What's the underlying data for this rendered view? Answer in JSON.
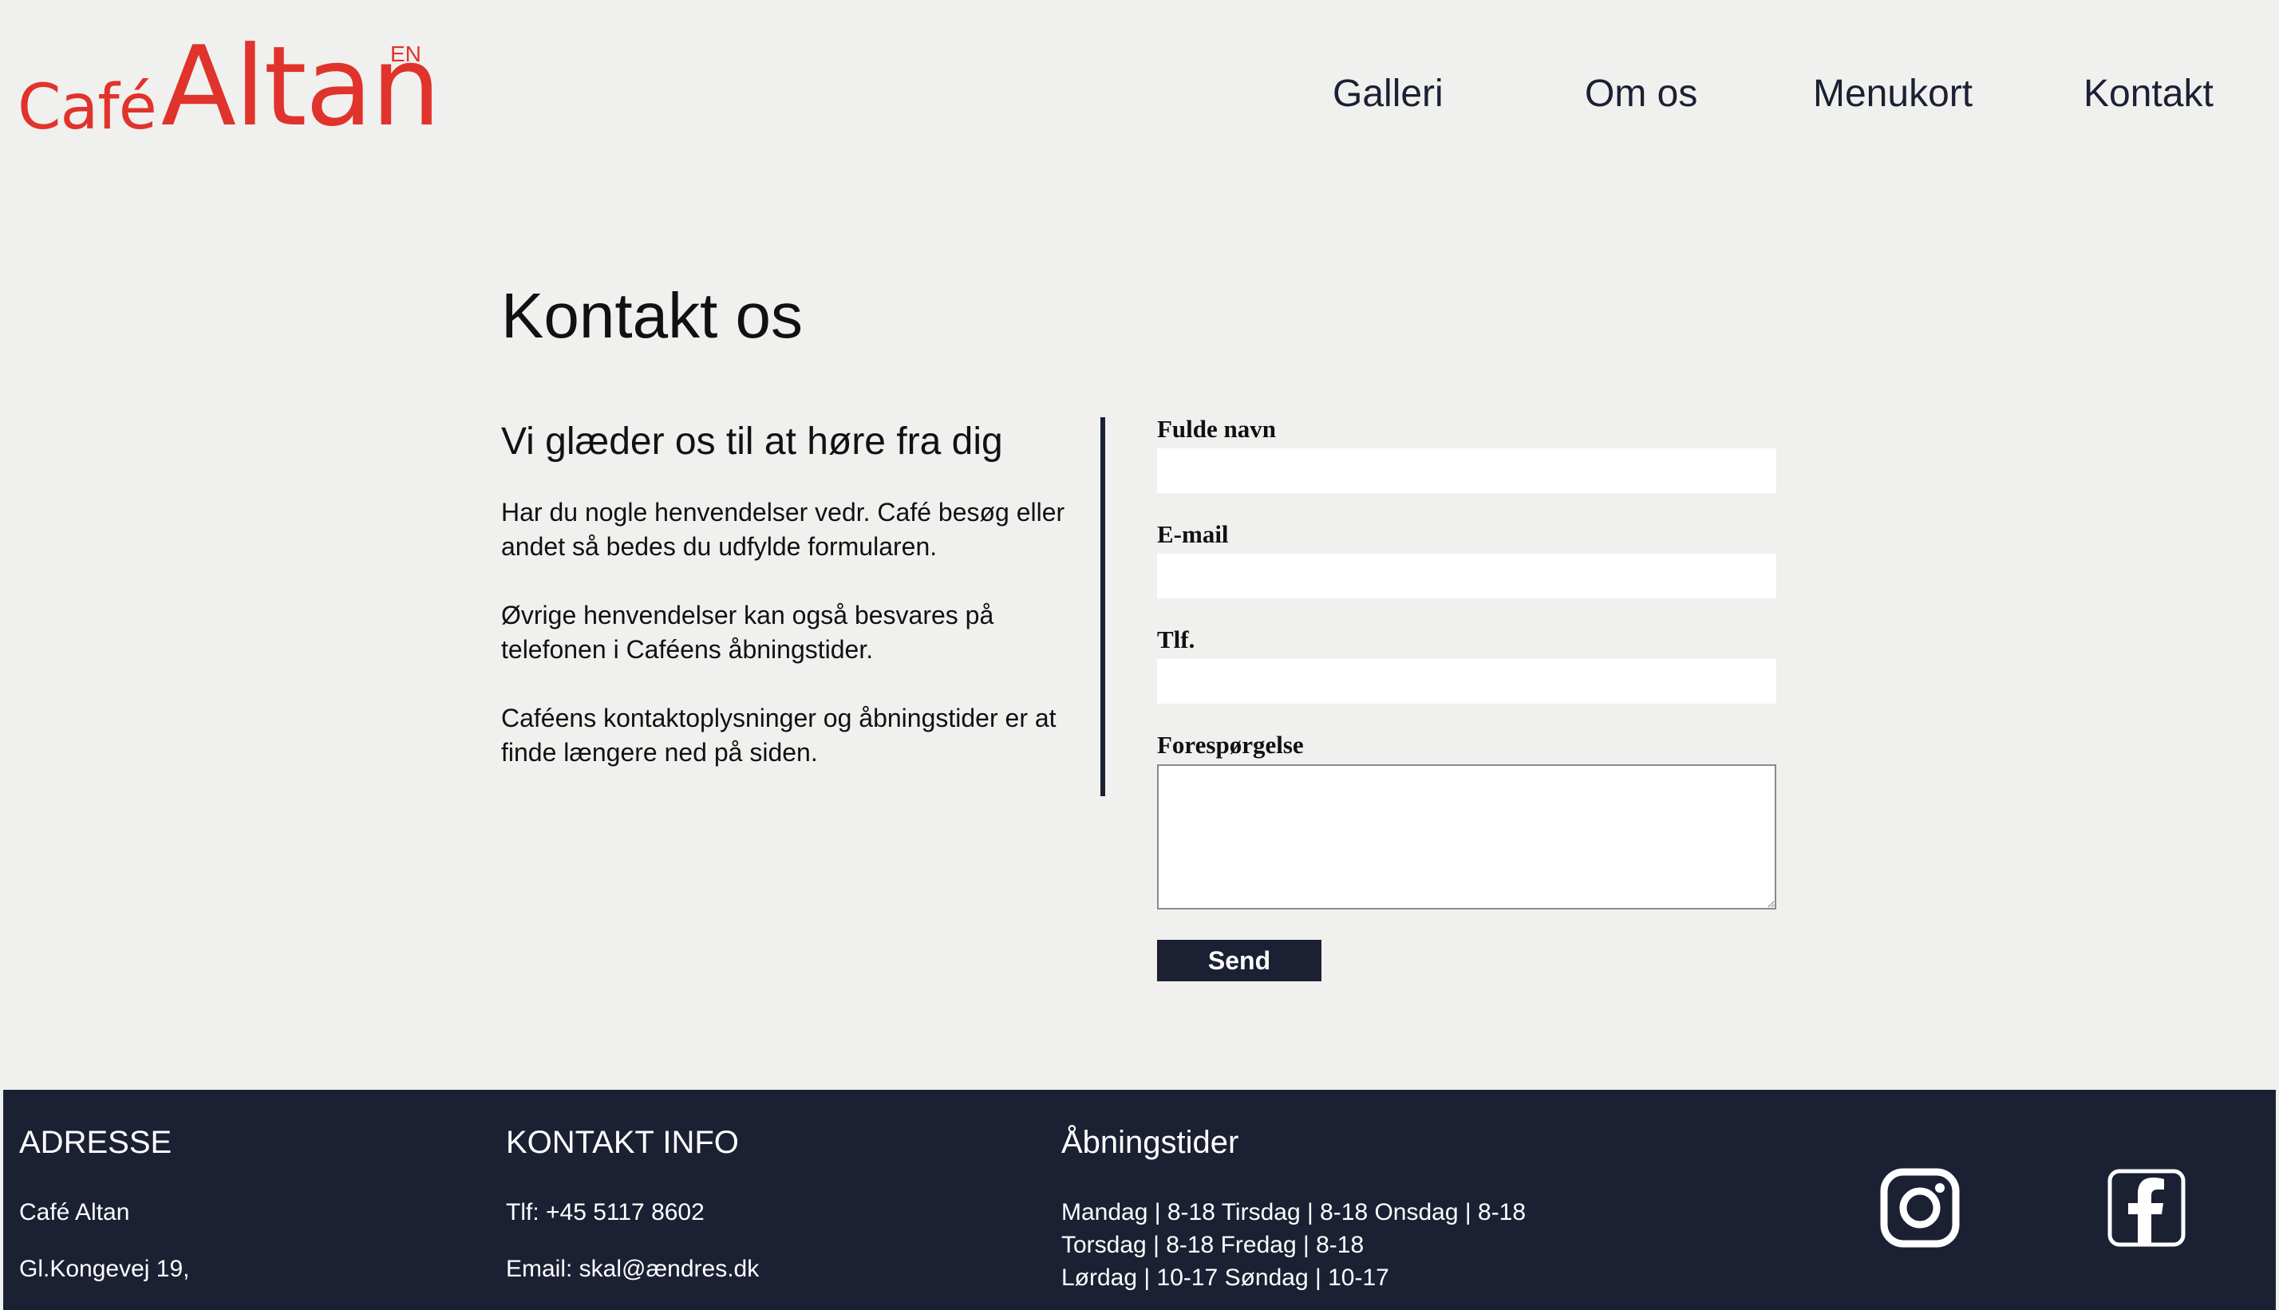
{
  "header": {
    "logo_cafe": "Café",
    "logo_altan": "Altan",
    "language_link": "EN",
    "nav": [
      "Galleri",
      "Om os",
      "Menukort",
      "Kontakt"
    ]
  },
  "main": {
    "title": "Kontakt os",
    "subtitle": "Vi glæder os til at høre fra dig",
    "paragraphs": [
      "Har du nogle henvendelser vedr. Café besøg eller andet så bedes du udfylde formularen.",
      "Øvrige henvendelser kan også besvares på telefonen i Caféens åbningstider.",
      "Caféens kontaktoplysninger og åbningstider er at finde længere ned på siden."
    ]
  },
  "form": {
    "name_label": "Fulde navn",
    "email_label": "E-mail",
    "phone_label": "Tlf.",
    "inquiry_label": "Forespørgelse",
    "name_value": "",
    "email_value": "",
    "phone_value": "",
    "inquiry_value": "",
    "submit_label": "Send"
  },
  "footer": {
    "address_heading": "ADRESSE",
    "address_name": "Café Altan",
    "address_street": "Gl.Kongevej 19,",
    "contact_heading": "KONTAKT INFO",
    "contact_phone": "Tlf: +45 5117 8602",
    "contact_email": "Email: skal@ændres.dk",
    "hours_heading": "Åbningstider",
    "hours_lines": [
      "Mandag | 8-18 Tirsdag | 8-18 Onsdag | 8-18",
      "Torsdag | 8-18 Fredag | 8-18",
      "Lørdag | 10-17 Søndag | 10-17"
    ],
    "social": [
      "instagram-icon",
      "facebook-icon"
    ]
  },
  "colors": {
    "brand_red": "#e0332b",
    "navy": "#1b2033",
    "background": "#f0f0ee"
  }
}
